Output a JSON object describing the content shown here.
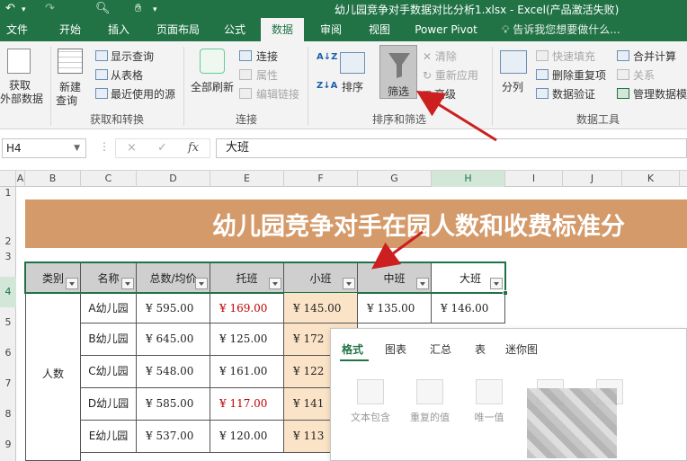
{
  "app": {
    "title": "幼儿园竞争对手数据对比分析1.xlsx - Excel(产品激活失败)"
  },
  "tabs": [
    "文件",
    "开始",
    "插入",
    "页面布局",
    "公式",
    "数据",
    "审阅",
    "视图",
    "Power Pivot"
  ],
  "active_tab": "数据",
  "tell_me": "告诉我您想要做什么...",
  "ribbon": {
    "get_data": [
      "获取",
      "外部数据"
    ],
    "new_query": [
      "新建",
      "查询"
    ],
    "show_query": "显示查询",
    "from_table": "从表格",
    "recent_sources": "最近使用的源",
    "group_get_transform": "获取和转换",
    "refresh_all": "全部刷新",
    "connections": "连接",
    "properties": "属性",
    "edit_links": "编辑链接",
    "group_connections": "连接",
    "sort_az": "A↓Z",
    "sort_za": "Z↓A",
    "sort": "排序",
    "filter": "筛选",
    "clear": "清除",
    "reapply": "重新应用",
    "advanced": "高级",
    "group_sort_filter": "排序和筛选",
    "text_to_columns": "分列",
    "flash_fill": "快速填充",
    "remove_duplicates": "删除重复项",
    "data_validation": "数据验证",
    "consolidate": "合并计算",
    "relationships": "关系",
    "manage_data_model": "管理数据模",
    "group_data_tools": "数据工具"
  },
  "formula_bar": {
    "name_box": "H4",
    "cancel": "×",
    "enter": "✓",
    "fx": "fx",
    "content": "大班"
  },
  "columns": [
    "A",
    "B",
    "C",
    "D",
    "E",
    "F",
    "G",
    "H",
    "I",
    "J",
    "K"
  ],
  "rows": [
    "1",
    "2",
    "3",
    "4",
    "5",
    "6",
    "7",
    "8",
    "9"
  ],
  "sheet": {
    "banner_title": "幼儿园竞争对手在园人数和收费标准分",
    "headers": [
      "类别",
      "名称",
      "总数/均价",
      "托班",
      "小班",
      "中班",
      "大班"
    ],
    "category": "人数",
    "table_rows": [
      {
        "name": "A幼儿园",
        "total": "¥ 595.00",
        "tuo": "¥ 169.00",
        "xiao": "¥ 145.00",
        "zhong": "¥ 135.00",
        "da": "¥ 146.00"
      },
      {
        "name": "B幼儿园",
        "total": "¥ 645.00",
        "tuo": "¥ 125.00",
        "xiao": "¥ 172"
      },
      {
        "name": "C幼儿园",
        "total": "¥ 548.00",
        "tuo": "¥ 161.00",
        "xiao": "¥ 122"
      },
      {
        "name": "D幼儿园",
        "total": "¥ 585.00",
        "tuo": "¥ 117.00",
        "xiao": "¥ 141"
      },
      {
        "name": "E幼儿园",
        "total": "¥ 537.00",
        "tuo": "¥ 120.00",
        "xiao": "¥ 113"
      }
    ]
  },
  "quick_analysis": {
    "tabs": [
      "格式",
      "图表",
      "汇总",
      "表",
      "迷你图"
    ],
    "items": [
      "文本包含",
      "重复的值",
      "唯一值"
    ]
  },
  "colors": {
    "excel_green": "#217346",
    "banner": "#d49a6a",
    "header_gray": "#cfcfcf",
    "peach": "#fbe3c8",
    "red_value": "#c00000",
    "arrow": "#cc1f1f"
  }
}
